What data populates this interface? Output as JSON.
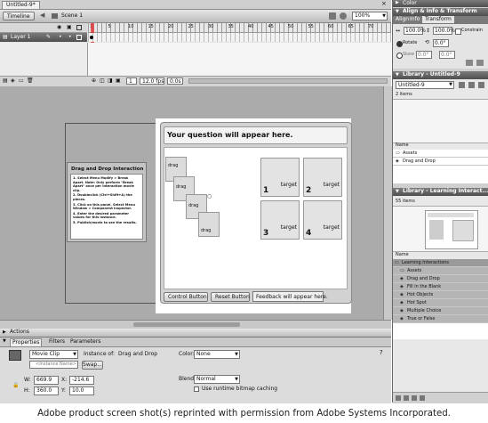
{
  "document": {
    "tab": "Untitled-9*",
    "timeline_button": "Timeline",
    "scene": "Scene 1",
    "zoom": "100%"
  },
  "timeline": {
    "layer_name": "Layer 1",
    "frame_numbers": [
      "1",
      "5",
      "10",
      "15",
      "20",
      "25",
      "30",
      "35",
      "40",
      "45",
      "50",
      "55",
      "60",
      "65",
      "70"
    ],
    "current_frame": "1",
    "fps": "12.0 fps",
    "elapsed": "0.0s"
  },
  "stage": {
    "instructions": {
      "title": "Drag and Drop Interaction",
      "steps": [
        "1. Select Menu Modify > Break Apart. Note: Only perform \"Break Apart\" once per interaction movie clip.",
        "2. Doubleclick (Ctrl+Shift+A) the pieces.",
        "3. Click on this panel. Select Menu Window > Component Inspector.",
        "4. Enter the desired parameter values for this instance.",
        "5. Publish/movie to see the results."
      ]
    },
    "question": "Your question will appear here.",
    "drags": [
      "drag",
      "drag",
      "drag",
      "drag"
    ],
    "targets": [
      {
        "label": "target",
        "num": "1"
      },
      {
        "label": "target",
        "num": "2"
      },
      {
        "label": "target",
        "num": "3"
      },
      {
        "label": "target",
        "num": "4"
      }
    ],
    "control_button": "Control Button",
    "reset_button": "Reset Button",
    "feedback": "Feedback will appear here."
  },
  "actions_panel": {
    "title": "Actions"
  },
  "properties": {
    "tabs": [
      "Properties",
      "Filters",
      "Parameters"
    ],
    "symbol_type": "Movie Clip",
    "instance_name_placeholder": "<Instance Name>",
    "instance_of_label": "Instance of:",
    "instance_of_value": "Drag and Drop",
    "swap_button": "Swap...",
    "color_label": "Color:",
    "color_value": "None",
    "blend_label": "Blend:",
    "blend_value": "Normal",
    "cache_label": "Use runtime bitmap caching",
    "w_label": "W:",
    "w_value": "669.9",
    "x_label": "X:",
    "x_value": "-214.6",
    "h_label": "H:",
    "h_value": "360.0",
    "y_label": "Y:",
    "y_value": "10.0"
  },
  "right_panels": {
    "color_title": "Color",
    "align_title": "Align & Info & Transform",
    "align_tabs": [
      "Align",
      "Info",
      "Transform"
    ],
    "scale_w": "100.0%",
    "scale_h": "100.0%",
    "constrain": "Constrain",
    "rotate": "Rotate",
    "rotate_value": "0.0°",
    "skew": "Skew",
    "skew_value1": "0.0°",
    "skew_value2": "0.0°",
    "library1_title": "Library - Untitled-9",
    "library1_doc": "Untitled-9",
    "library1_count": "2 items",
    "name_header": "Name",
    "library1_items": [
      "Assets",
      "Drag and Drop"
    ],
    "library2_title": "Library - Learning Interact...",
    "library2_count": "55 items",
    "library2_items": [
      "Learning Interactions",
      "Assets",
      "Drag and Drop",
      "Fill in the Blank",
      "Hot Objects",
      "Hot Spot",
      "Multiple Choice",
      "True or False"
    ]
  },
  "caption": "Adobe product screen shot(s) reprinted with permission from Adobe Systems Incorporated."
}
